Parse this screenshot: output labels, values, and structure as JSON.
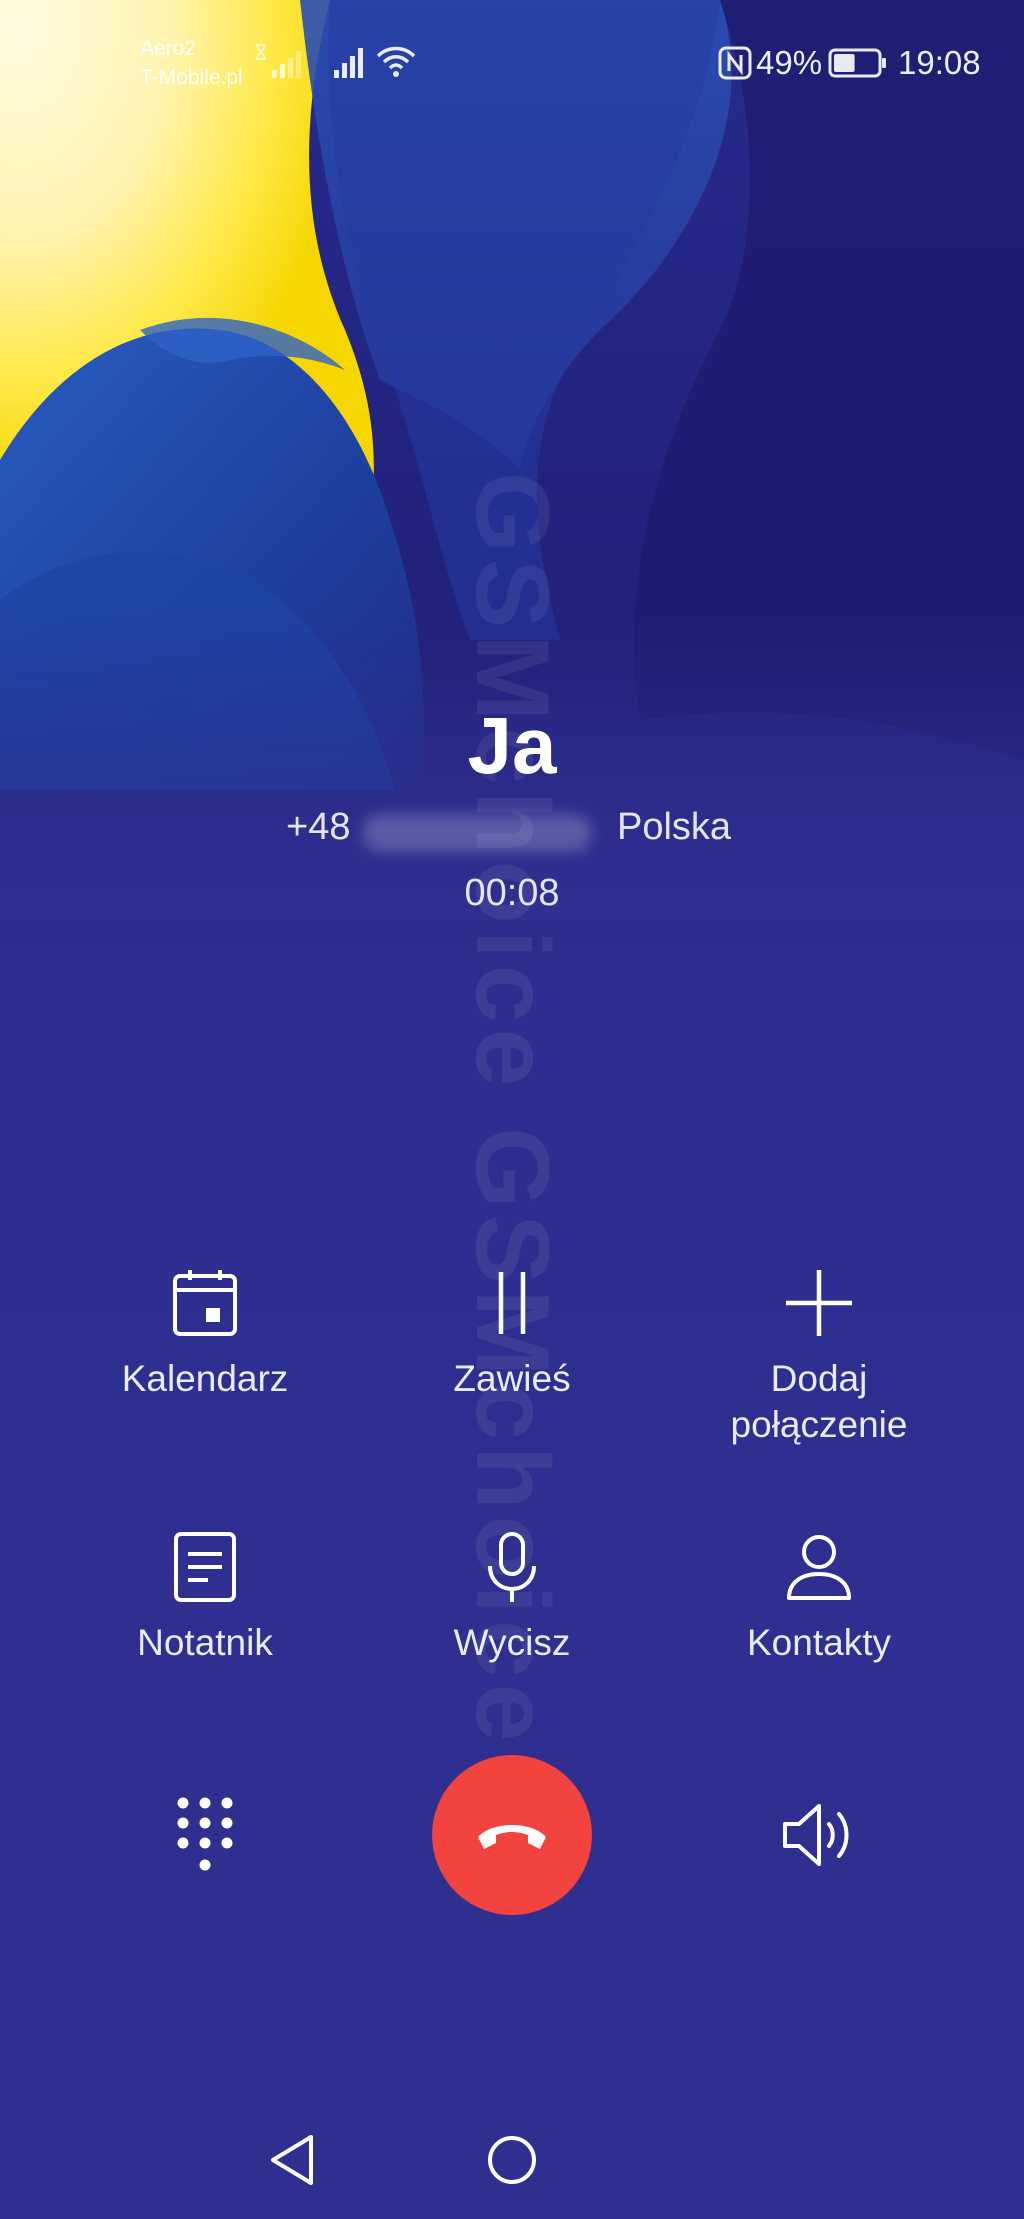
{
  "status_bar": {
    "carrier_line1": "Aero2",
    "carrier_line2": "T-Mobile.pl",
    "battery_percent": "49%",
    "time": "19:08",
    "icons": [
      "hourglass-icon",
      "signal-icon-sim1",
      "signal-icon-sim2",
      "wifi-icon",
      "nfc-icon",
      "battery-icon"
    ],
    "battery_level": 0.49
  },
  "watermark": "GSMchoice GSMchoice",
  "call": {
    "caller_name": "Ja",
    "number_prefix": "+48",
    "country": "Polska",
    "duration": "00:08"
  },
  "actions": [
    {
      "label": "Kalendarz",
      "icon": "calendar-icon"
    },
    {
      "label": "Zawieś",
      "icon": "pause-icon"
    },
    {
      "label": "Dodaj\npołączenie",
      "icon": "plus-icon"
    },
    {
      "label": "Notatnik",
      "icon": "notepad-icon"
    },
    {
      "label": "Wycisz",
      "icon": "microphone-icon"
    },
    {
      "label": "Kontakty",
      "icon": "contact-icon"
    }
  ],
  "bottom_controls": {
    "dialpad_icon": "dialpad-icon",
    "end_call_icon": "end-call-icon",
    "speaker_icon": "speaker-icon"
  },
  "nav_bar": {
    "back_icon": "back-icon",
    "home_icon": "home-icon"
  },
  "colors": {
    "background": "#2e2f8f",
    "end_call": "#f2433e",
    "wallpaper_yellow": "#ffe033",
    "wallpaper_cream": "#fff6c4",
    "wallpaper_blue": "#1f47a8"
  }
}
